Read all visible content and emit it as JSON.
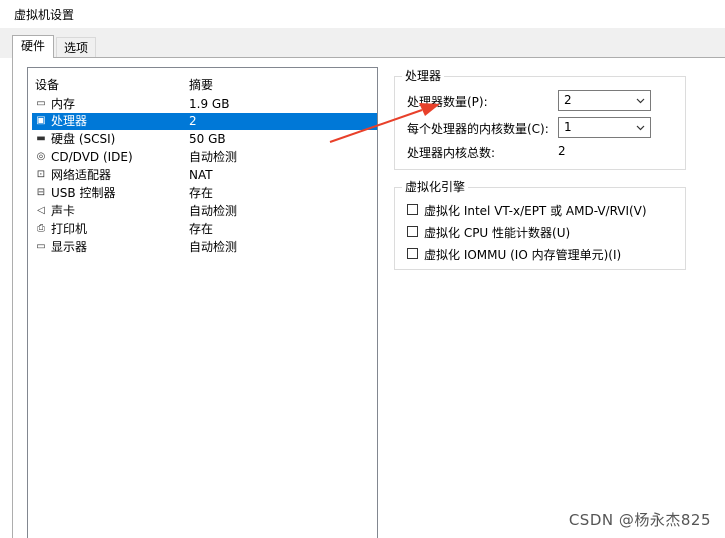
{
  "window": {
    "title": "虚拟机设置"
  },
  "tabs": [
    {
      "label": "硬件",
      "active": true
    },
    {
      "label": "选项",
      "active": false
    }
  ],
  "device_list": {
    "headers": {
      "device": "设备",
      "summary": "摘要"
    },
    "rows": [
      {
        "icon": "memory-icon",
        "name": "内存",
        "summary": "1.9 GB",
        "selected": false
      },
      {
        "icon": "processor-icon",
        "name": "处理器",
        "summary": "2",
        "selected": true
      },
      {
        "icon": "hard-disk-icon",
        "name": "硬盘 (SCSI)",
        "summary": "50 GB",
        "selected": false
      },
      {
        "icon": "cd-dvd-icon",
        "name": "CD/DVD (IDE)",
        "summary": "自动检测",
        "selected": false
      },
      {
        "icon": "network-adapter-icon",
        "name": "网络适配器",
        "summary": "NAT",
        "selected": false
      },
      {
        "icon": "usb-controller-icon",
        "name": "USB 控制器",
        "summary": "存在",
        "selected": false
      },
      {
        "icon": "sound-card-icon",
        "name": "声卡",
        "summary": "自动检测",
        "selected": false
      },
      {
        "icon": "printer-icon",
        "name": "打印机",
        "summary": "存在",
        "selected": false
      },
      {
        "icon": "display-icon",
        "name": "显示器",
        "summary": "自动检测",
        "selected": false
      }
    ]
  },
  "processor_group": {
    "title": "处理器",
    "count_label": "处理器数量(P):",
    "count_value": "2",
    "cores_label": "每个处理器的内核数量(C):",
    "cores_value": "1",
    "total_label": "处理器内核总数:",
    "total_value": "2"
  },
  "virtualization_group": {
    "title": "虚拟化引擎",
    "options": [
      {
        "label": "虚拟化 Intel VT-x/EPT 或 AMD-V/RVI(V)",
        "checked": false
      },
      {
        "label": "虚拟化 CPU 性能计数器(U)",
        "checked": false
      },
      {
        "label": "虚拟化 IOMMU (IO 内存管理单元)(I)",
        "checked": false
      }
    ]
  },
  "annotation": {
    "arrow_color": "#e8402a"
  },
  "watermark": "CSDN @杨永杰825",
  "colors": {
    "selection": "#0078d7",
    "border": "#adadad"
  }
}
